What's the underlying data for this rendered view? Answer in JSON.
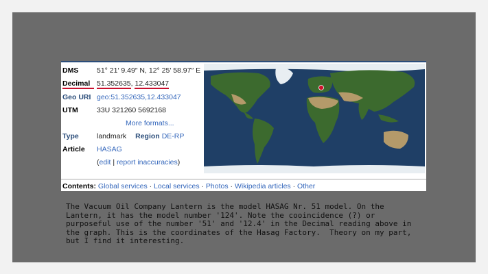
{
  "coords": {
    "dms_label": "DMS",
    "dms_value": "51° 21′ 9.49″ N, 12° 25′ 58.97″ E",
    "decimal_label": "Decimal",
    "decimal_lat": "51.352635",
    "decimal_sep": ", ",
    "decimal_lon": "12.433047",
    "geouri_label": "Geo URI",
    "geouri_value": "geo:51.352635,12.433047",
    "utm_label": "UTM",
    "utm_value": "33U 321260 5692168",
    "more_formats": "More formats...",
    "type_label": "Type",
    "type_value": "landmark",
    "region_label": "Region",
    "region_value": "DE-RP",
    "article_label": "Article",
    "article_value": "HASAG",
    "edit_open": "(",
    "edit_link": "edit",
    "edit_sep": " | ",
    "report_link": "report inaccuracies",
    "edit_close": ")"
  },
  "contents": {
    "label": "Contents:",
    "items": [
      "Global services",
      "Local services",
      "Photos",
      "Wikipedia articles",
      "Other"
    ],
    "separator": " · "
  },
  "caption": "The Vacuum Oil Company Lantern is the model HASAG Nr. 51 model. On the Lantern, it has the model number '124'. Note the cooincidence (?) or purposeful use of the number '51' and '12.4' in the Decimal reading above in the graph. This is the coordinates of the Hasag Factory.  Theory on my part, but I find it interesting.",
  "colors": {
    "ocean": "#1f3f66",
    "land": "#3c6a2e",
    "desert": "#b49a6a",
    "ice": "#e8eef2",
    "marker": "#d0102a",
    "header_blue": "#2b4d7a",
    "link": "#3366bb"
  }
}
